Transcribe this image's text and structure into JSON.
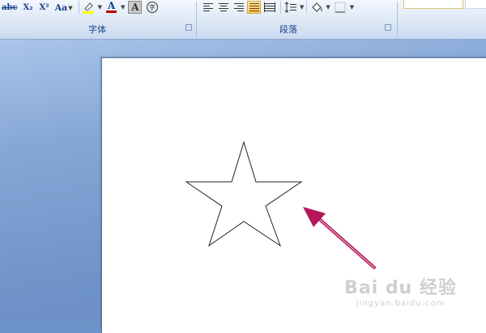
{
  "ribbon": {
    "font_group": {
      "label": "字体",
      "buttons": [
        "abc",
        "X₂",
        "X²",
        "Aa"
      ],
      "font_color_letter": "A",
      "char_border_letter": "A",
      "enclosed_char": "字"
    },
    "paragraph_group": {
      "label": "段落"
    },
    "colors": {
      "highlight": "#ffff00",
      "font_color": "#c00000",
      "accent": "#15428b"
    }
  },
  "document": {
    "shape": "star",
    "annotation_color": "#b5185a"
  },
  "watermark": {
    "brand": "Bai du 经验",
    "sub": "jingyan.baidu.com"
  }
}
